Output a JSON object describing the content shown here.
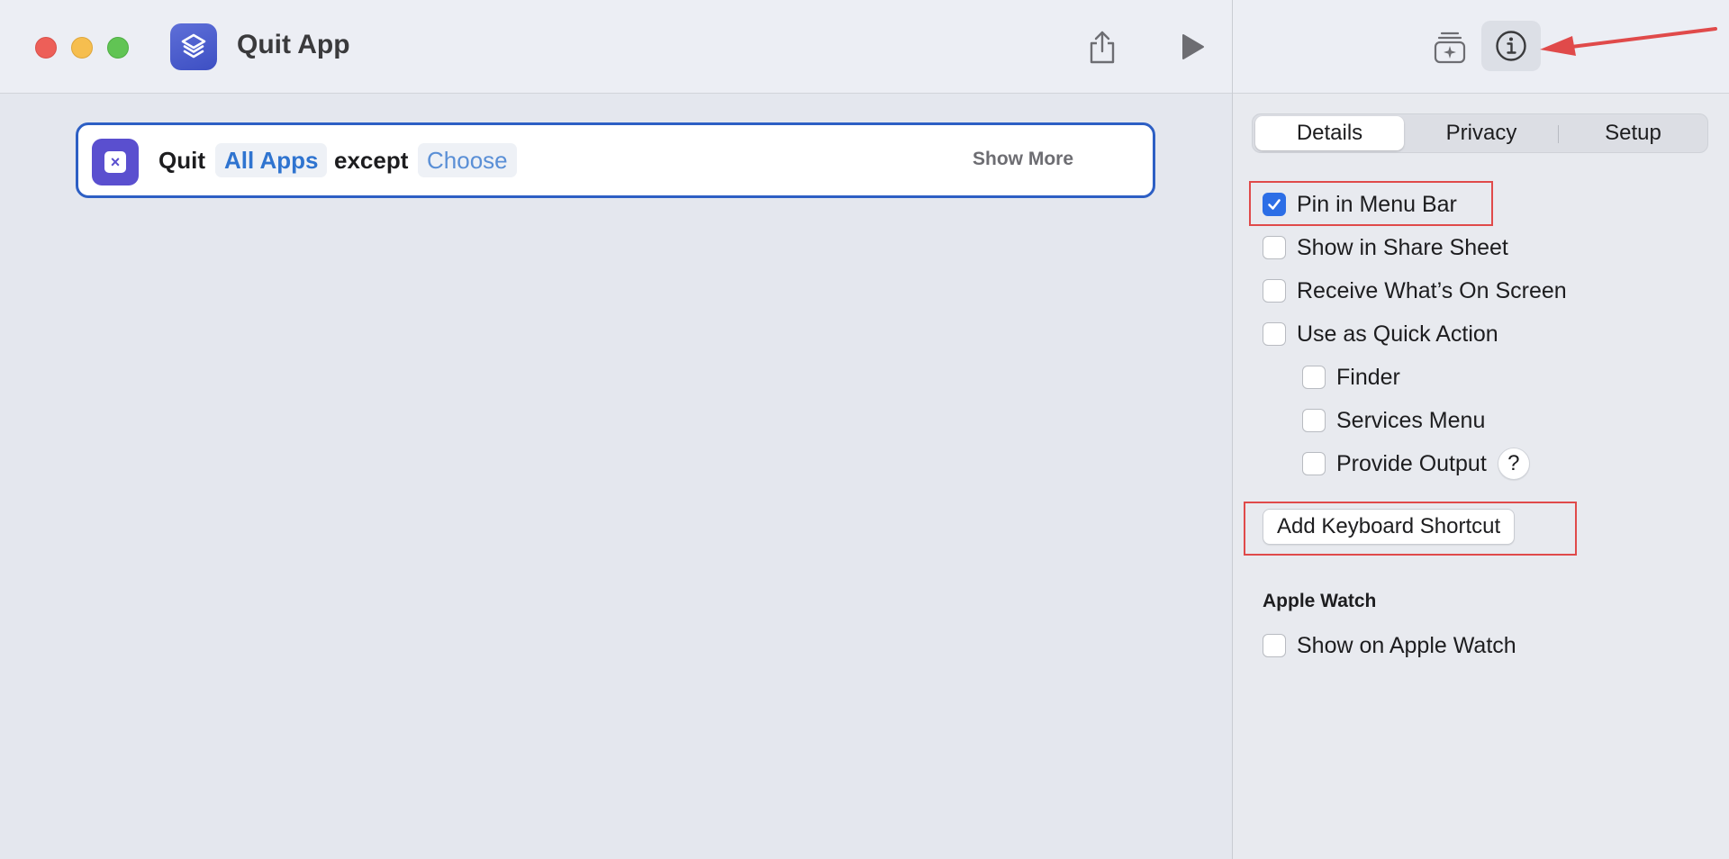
{
  "window": {
    "title": "Quit App"
  },
  "toolbar": {
    "share_icon": "share-icon",
    "run_icon": "play-icon"
  },
  "action": {
    "verb": "Quit",
    "target": "All Apps",
    "connector": "except",
    "exception_placeholder": "Choose",
    "show_more": "Show More"
  },
  "sidebar": {
    "tabs": [
      "Details",
      "Privacy",
      "Setup"
    ],
    "selected_tab": "Details",
    "options": [
      {
        "label": "Pin in Menu Bar",
        "checked": true
      },
      {
        "label": "Show in Share Sheet",
        "checked": false
      },
      {
        "label": "Receive What’s On Screen",
        "checked": false
      },
      {
        "label": "Use as Quick Action",
        "checked": false
      }
    ],
    "quick_action_options": [
      {
        "label": "Finder",
        "checked": false
      },
      {
        "label": "Services Menu",
        "checked": false
      },
      {
        "label": "Provide Output",
        "checked": false
      }
    ],
    "help_label": "?",
    "keyboard_shortcut_button": "Add Keyboard Shortcut",
    "apple_watch": {
      "heading": "Apple Watch",
      "option": {
        "label": "Show on Apple Watch",
        "checked": false
      }
    }
  },
  "colors": {
    "accent": "#2c6ee6",
    "action_border": "#2d5fc4",
    "annotation": "#e04a4a"
  }
}
